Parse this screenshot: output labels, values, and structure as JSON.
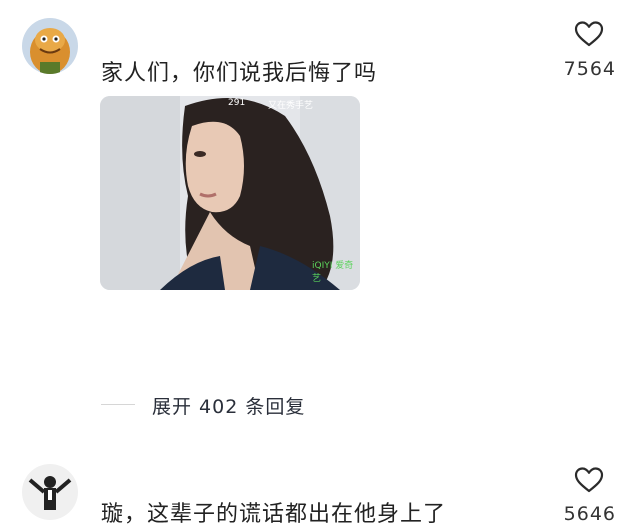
{
  "comments": [
    {
      "text": "家人们，你们说我后悔了吗",
      "likes": "7564",
      "media": {
        "top_left_badge": "291",
        "top_right_caption": "又在秀手艺",
        "watermark": "iQIYI 爱奇艺"
      },
      "expand_replies": "展开 402 条回复"
    },
    {
      "text": "璇，这辈子的谎话都出在他身上了",
      "likes": "5646"
    }
  ],
  "icons": {
    "like": "heart-outline-icon"
  },
  "colors": {
    "text": "#222222",
    "count": "#333333",
    "divider": "#d6d6d6"
  }
}
